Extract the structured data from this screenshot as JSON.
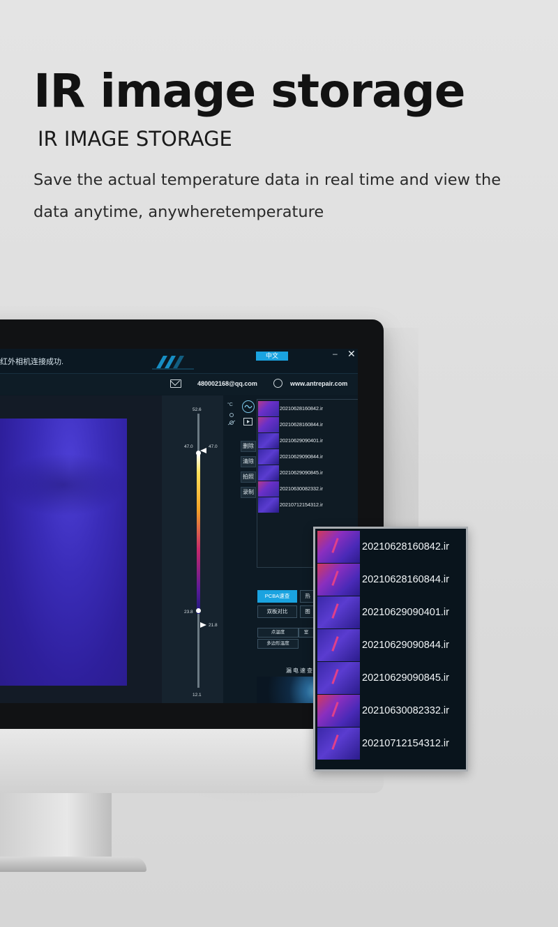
{
  "hero": {
    "title": "IR image storage",
    "subtitle": "IR IMAGE STORAGE",
    "description": "Save the actual temperature data in real time and view the data anytime, anywheretemperature"
  },
  "app": {
    "status_message": "红外相机连接成功.",
    "language_button": "中文",
    "minimize_label": "–",
    "close_label": "✕",
    "email": "480002168@qq.com",
    "website": "www.antrepair.com",
    "unit": "°C",
    "scale": {
      "max_label": "52.6",
      "high_left": "47.0",
      "high_right": "47.0",
      "low_left": "23.8",
      "low_right": "21.8",
      "min_label": "12.1"
    },
    "tools": [
      "删除",
      "清除",
      "拍照",
      "录制"
    ],
    "files": [
      "20210628160842.ir",
      "20210628160844.ir",
      "20210629090401.ir",
      "20210629090844.ir",
      "20210629090845.ir",
      "20210630082332.ir",
      "20210712154312.ir"
    ],
    "modes": {
      "pcba": "PCBA速查",
      "mode2": "热",
      "dual_compare": "双板对比",
      "mode4": "图"
    },
    "temp_options": {
      "point": "点温度",
      "mode2": "室",
      "polygon": "多边形温度"
    },
    "brand_caption": "漏电速查"
  },
  "popup": {
    "files": [
      "20210628160842.ir",
      "20210628160844.ir",
      "20210629090401.ir",
      "20210629090844.ir",
      "20210629090845.ir",
      "20210630082332.ir",
      "20210712154312.ir"
    ]
  },
  "colors": {
    "accent": "#1aa3e0",
    "thermal_purple": "#3a2cb8",
    "screen_bg": "#0d1a24"
  }
}
